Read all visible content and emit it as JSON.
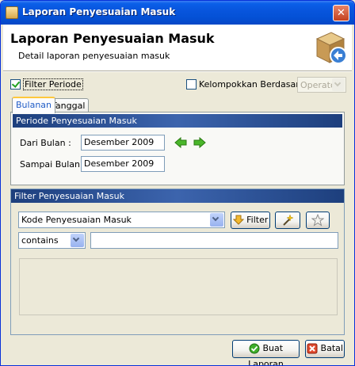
{
  "window": {
    "title": "Laporan Penyesuaian Masuk"
  },
  "header": {
    "title": "Laporan Penyesuaian Masuk",
    "subtitle": "Detail laporan penyesuaian masuk"
  },
  "options": {
    "filter_periode_label": "Filter Periode",
    "filter_periode_checked": true,
    "group_label": "Kelompokkan Berdasarkan :",
    "group_checked": false,
    "group_value": "Operator"
  },
  "tabs": [
    {
      "label": "Bulanan",
      "active": true
    },
    {
      "label": "Tanggal",
      "active": false
    }
  ],
  "periode": {
    "title": "Periode Penyesuaian Masuk",
    "from_label": "Dari Bulan :",
    "from_value": "Desember 2009",
    "to_label": "Sampai Bulan :",
    "to_value": "Desember 2009"
  },
  "filter": {
    "title": "Filter Penyesuaian Masuk",
    "field_value": "Kode Penyesuaian Masuk",
    "filter_button": "Filter",
    "operator_value": "contains",
    "text_value": ""
  },
  "footer": {
    "ok_button": "Buat Laporan",
    "cancel_button": "Batal"
  },
  "colors": {
    "titlebar": "#0855dd",
    "panel_header": "#1d3f7d",
    "tab_highlight": "#ffc83c"
  }
}
